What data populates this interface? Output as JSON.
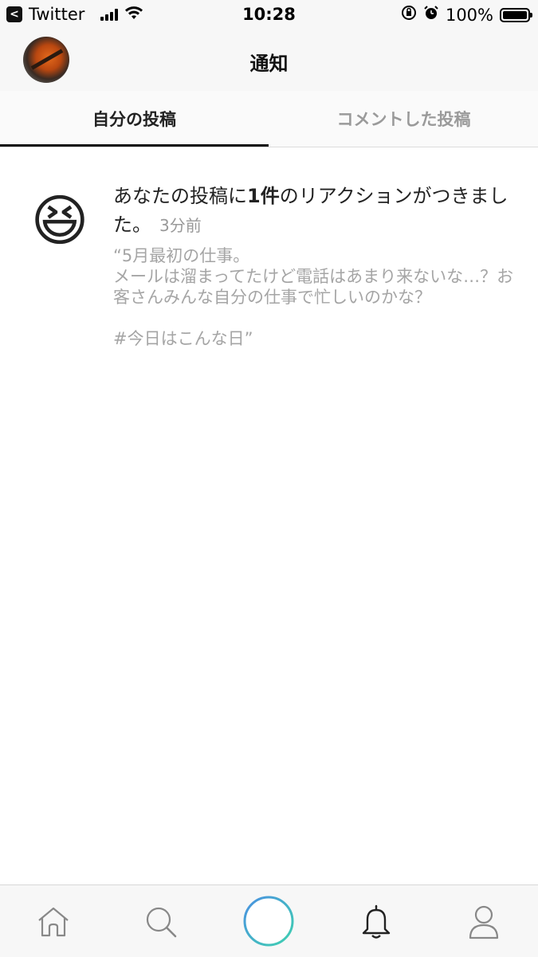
{
  "status_bar": {
    "app_back": "Twitter",
    "time": "10:28",
    "battery": "100%"
  },
  "header": {
    "title": "通知"
  },
  "tabs": [
    {
      "label": "自分の投稿",
      "active": true
    },
    {
      "label": "コメントした投稿",
      "active": false
    }
  ],
  "notification": {
    "emoji": "😆",
    "text_prefix": "あなたの投稿に",
    "text_count": "1件",
    "text_suffix": "のリアクションがつきました。",
    "time": "3分前",
    "quote": "“5月最初の仕事。\nメールは溜まってたけど電話はあまり来ないな…？お客さんみんな自分の仕事で忙しいのかな？\n\n #今日はこんな日”"
  },
  "bottom_nav": {
    "items": [
      "home",
      "search",
      "post",
      "notifications",
      "profile"
    ],
    "accent_gradient": [
      "#4a90e2",
      "#3fd1b0"
    ]
  }
}
